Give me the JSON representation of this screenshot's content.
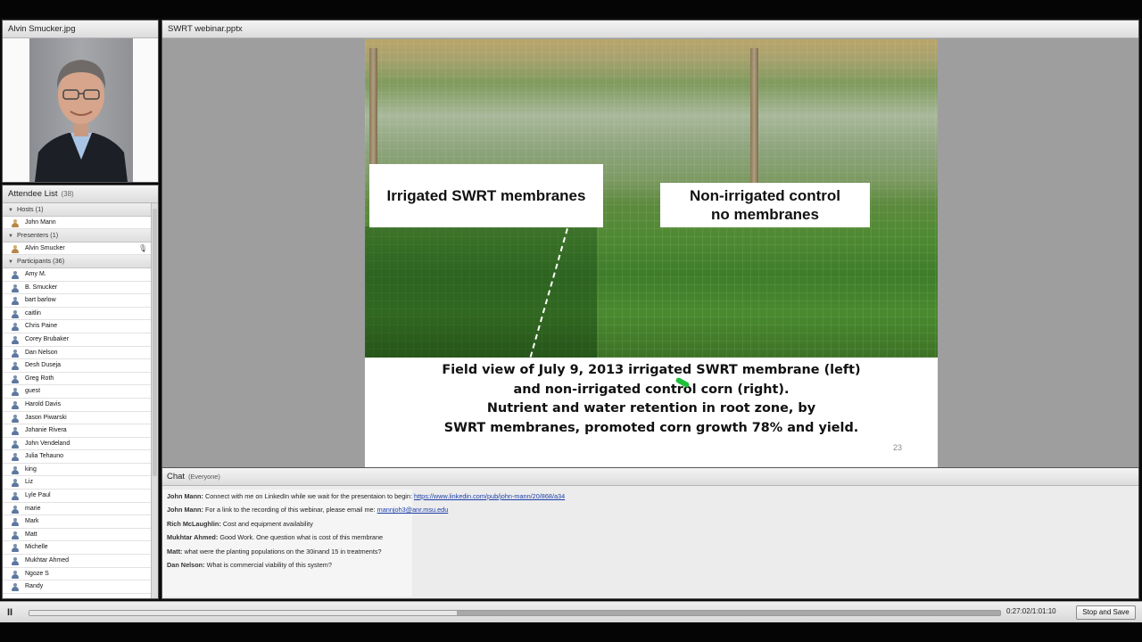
{
  "video_pod": {
    "title": "Alvin Smucker.jpg"
  },
  "attendee_pod": {
    "title": "Attendee List",
    "count": "(38)",
    "hosts": {
      "label": "Hosts (1)",
      "people": [
        "John Mann"
      ]
    },
    "presenters": {
      "label": "Presenters (1)",
      "people": [
        "Alvin Smucker"
      ]
    },
    "participants": {
      "label": "Participants (36)",
      "people": [
        "Amy M.",
        "B. Smucker",
        "bart barlow",
        "caitlin",
        "Chris Paine",
        "Corey Brubaker",
        "Dan Nelson",
        "Desh Duseja",
        "Greg Roth",
        "guest",
        "Harold Davis",
        "Jason Piwarski",
        "Johanie Rivera",
        "John Vendeland",
        "Julia Tehauno",
        "king",
        "Liz",
        "Lyle Paul",
        "marie",
        "Mark",
        "Matt",
        "Michelle",
        "Mukhtar Ahmed",
        "Ngoze S",
        "Randy"
      ]
    }
  },
  "share_pod": {
    "title": "SWRT webinar.pptx",
    "slide": {
      "label_left": "Irrigated SWRT membranes",
      "label_right": "Non-irrigated control\nno membranes",
      "caption": [
        "Field view of July 9, 2013 irrigated SWRT membrane (left)",
        "and non-irrigated control corn (right).",
        "Nutrient and water retention in root zone, by",
        "SWRT membranes, promoted corn growth 78% and yield."
      ],
      "page_number": "23"
    }
  },
  "chat_pod": {
    "title": "Chat",
    "scope": "(Everyone)",
    "messages": [
      {
        "sender": "John Mann:",
        "text": "Connect with me on LinkedIn while we wait for the presentaion to begin:",
        "link": "https://www.linkedin.com/pub/john-mann/20/868/a34"
      },
      {
        "sender": "John Mann:",
        "text": "For a link to the recording of this webinar, please email me:",
        "link": "mannjoh3@anr.msu.edu"
      },
      {
        "sender": "Rich McLaughlin:",
        "text": "Cost and equipment availability",
        "link": ""
      },
      {
        "sender": "Mukhtar Ahmed:",
        "text": "Good Work. One question what is cost of this membrane",
        "link": ""
      },
      {
        "sender": "Matt:",
        "text": "what were the planting populations on the 30inand 15 in treatments?",
        "link": ""
      },
      {
        "sender": "Dan Nelson:",
        "text": "What is commercial viability of this system?",
        "link": ""
      }
    ]
  },
  "playback": {
    "progress_fraction": 0.44,
    "buffered_fraction": 1.0,
    "time": "0:27:02/1:01:10",
    "stop_save_label": "Stop and Save",
    "pause_symbol": "II"
  }
}
